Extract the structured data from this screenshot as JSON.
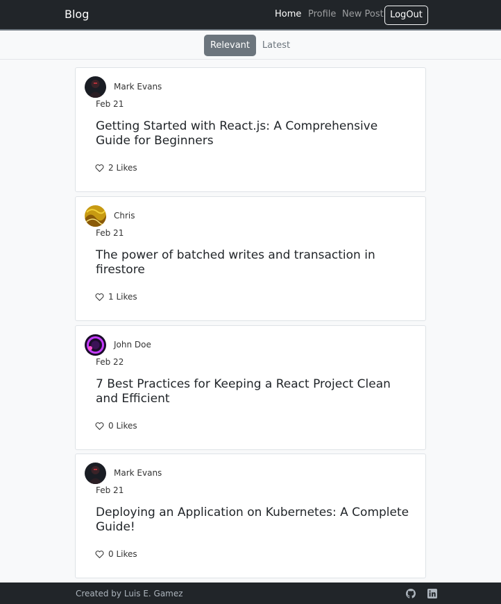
{
  "navbar": {
    "brand": "Blog",
    "links": [
      "Home",
      "Profile",
      "New Post"
    ],
    "logout": "LogOut"
  },
  "tabs": [
    "Relevant",
    "Latest"
  ],
  "posts": [
    {
      "author": "Mark Evans",
      "date": "Feb 21",
      "title": "Getting Started with React.js: A Comprehensive Guide for Beginners",
      "likes": "2 Likes",
      "avatar": "dark-figure-avatar"
    },
    {
      "author": "Chris",
      "date": "Feb 21",
      "title": "The power of batched writes and transaction in firestore",
      "likes": "1 Likes",
      "avatar": "yellow-pattern-avatar"
    },
    {
      "author": "John Doe",
      "date": "Feb 22",
      "title": "7 Best Practices for Keeping a React Project Clean and Efficient",
      "likes": "0 Likes",
      "avatar": "purple-glow-avatar"
    },
    {
      "author": "Mark Evans",
      "date": "Feb 21",
      "title": "Deploying an Application on Kubernetes: A Complete Guide!",
      "likes": "0 Likes",
      "avatar": "dark-figure-avatar"
    }
  ],
  "footer": {
    "credit": "Created by Luis E. Gamez",
    "icons": [
      "github-icon",
      "linkedin-icon"
    ]
  },
  "colors": {
    "navbar": "#212529",
    "tab_active": "#6c757d",
    "page_bg": "#f8f9fa"
  }
}
